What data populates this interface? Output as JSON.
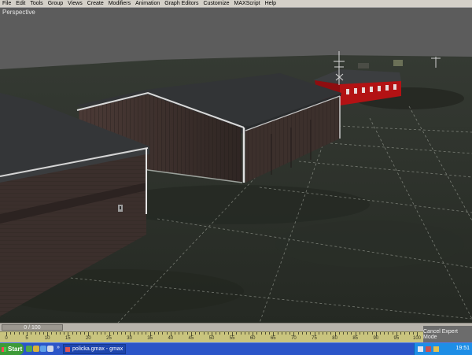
{
  "menu": [
    "File",
    "Edit",
    "Tools",
    "Group",
    "Views",
    "Create",
    "Modifiers",
    "Animation",
    "Graph Editors",
    "Customize",
    "MAXScript",
    "Help"
  ],
  "viewport": {
    "label": "Perspective"
  },
  "timeline": {
    "frame_text": "0 / 100",
    "ticks": [
      "0",
      "5",
      "10",
      "15",
      "20",
      "25",
      "30",
      "35",
      "40",
      "45",
      "50",
      "55",
      "60",
      "65",
      "70",
      "75",
      "80",
      "85",
      "90",
      "95",
      "100"
    ]
  },
  "cancel_expert_label": "Cancel Expert Mode",
  "taskbar": {
    "start_label": "Start",
    "chevron": "»",
    "task_label": "policka.gmax - gmax",
    "clock": "19:51"
  },
  "colors": {
    "ground": "#2c302a",
    "sky": "#5c5c5c",
    "hangar_wall": "#3a2e2b",
    "roof": "#323436",
    "red_building": "#b31214",
    "timeline_ruler": "#c9c47e",
    "taskbar": "#2b55c8"
  }
}
